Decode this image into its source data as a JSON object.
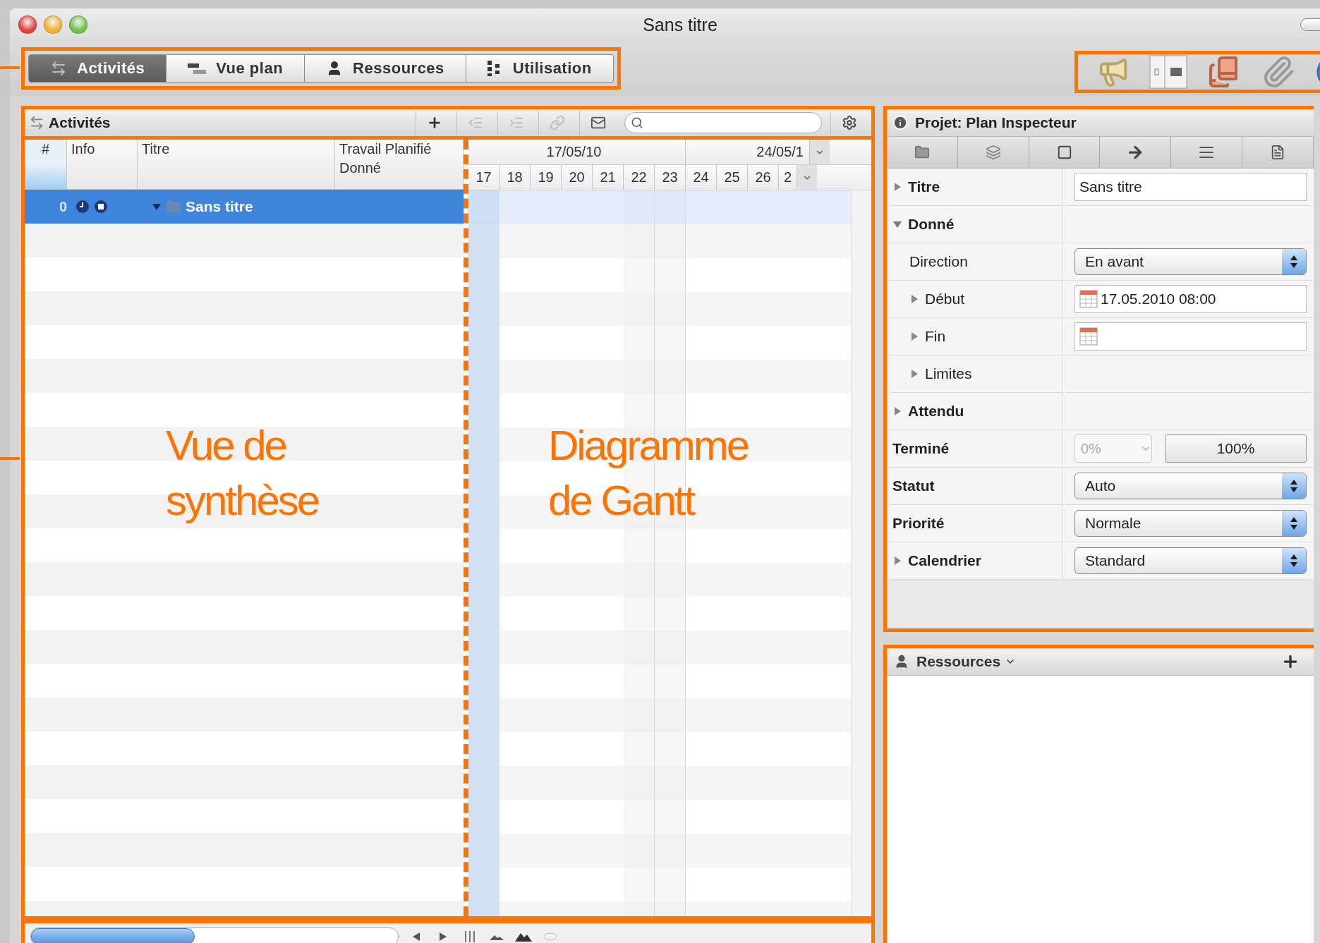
{
  "window": {
    "title": "Sans titre"
  },
  "view_tabs": [
    {
      "label": "Activités",
      "selected": true
    },
    {
      "label": "Vue plan",
      "selected": false
    },
    {
      "label": "Ressources",
      "selected": false
    },
    {
      "label": "Utilisation",
      "selected": false
    }
  ],
  "activities_panel": {
    "title": "Activités"
  },
  "table": {
    "columns": [
      {
        "label": "#"
      },
      {
        "label": "Info"
      },
      {
        "label": "Titre"
      },
      {
        "label": "Travail Planifié",
        "sublabel": "Donné"
      }
    ],
    "rows": [
      {
        "number": "0",
        "title": "Sans titre",
        "selected": true,
        "expanded": true
      }
    ]
  },
  "gantt": {
    "weeks": [
      "17/05/10",
      "24/05/1"
    ],
    "days": [
      {
        "label": "17",
        "today": true,
        "weekend": false
      },
      {
        "label": "18",
        "today": false,
        "weekend": false
      },
      {
        "label": "19",
        "today": false,
        "weekend": false
      },
      {
        "label": "20",
        "today": false,
        "weekend": false
      },
      {
        "label": "21",
        "today": false,
        "weekend": false
      },
      {
        "label": "22",
        "today": false,
        "weekend": true
      },
      {
        "label": "23",
        "today": false,
        "weekend": true
      },
      {
        "label": "24",
        "today": false,
        "weekend": false
      },
      {
        "label": "25",
        "today": false,
        "weekend": false
      },
      {
        "label": "26",
        "today": false,
        "weekend": false
      },
      {
        "label": "2",
        "today": false,
        "weekend": false
      }
    ]
  },
  "annotations": [
    {
      "text": "Vue de\nsynthèse"
    },
    {
      "text": "Diagramme\nde Gantt"
    }
  ],
  "inspector": {
    "title": "Projet: Plan Inspecteur",
    "rows": [
      {
        "kind": "text",
        "label": "Titre",
        "value": "Sans titre",
        "expanded": false
      },
      {
        "kind": "group",
        "label": "Donné",
        "expanded": true,
        "children": [
          {
            "kind": "select",
            "label": "Direction",
            "value": "En avant"
          },
          {
            "kind": "date",
            "label": "Début",
            "value": "17.05.2010 08:00",
            "expanded": false
          },
          {
            "kind": "date",
            "label": "Fin",
            "expanded": false
          },
          {
            "kind": "group",
            "label": "Limites",
            "expanded": false
          }
        ]
      },
      {
        "kind": "group",
        "label": "Attendu",
        "expanded": false
      },
      {
        "kind": "percent",
        "label": "Terminé",
        "value": "0%",
        "button": "100%",
        "disabled": true
      },
      {
        "kind": "select",
        "label": "Statut",
        "value": "Auto"
      },
      {
        "kind": "select",
        "label": "Priorité",
        "value": "Normale"
      },
      {
        "kind": "select",
        "label": "Calendrier",
        "value": "Standard",
        "expanded": false
      }
    ]
  },
  "resources_panel": {
    "title": "Ressources"
  }
}
